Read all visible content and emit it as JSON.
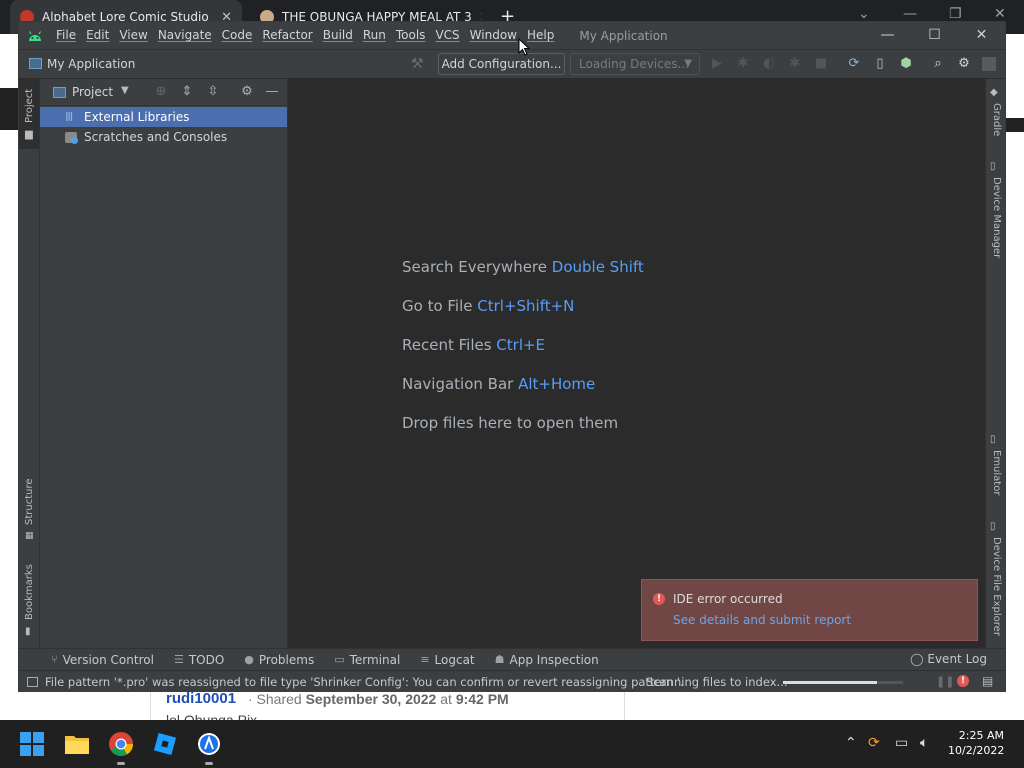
{
  "browser": {
    "tabs": [
      {
        "title": "Alphabet Lore Comic Studio",
        "active": true
      },
      {
        "title": "THE OBUNGA HAPPY MEAL AT 3",
        "active": false
      }
    ],
    "new_tab": "+",
    "close_glyph": "✕",
    "page": {
      "user": "rudi10001",
      "shared_prefix": "· Shared ",
      "shared_date": "September 30, 2022",
      "shared_at": " at ",
      "shared_time": "9:42 PM",
      "line2": "lol Obunga Pix"
    }
  },
  "ide": {
    "app_icon": "android-studio-icon",
    "menu": [
      "File",
      "Edit",
      "View",
      "Navigate",
      "Code",
      "Refactor",
      "Build",
      "Run",
      "Tools",
      "VCS",
      "Window",
      "Help"
    ],
    "window_title": "My Application",
    "project_name": "My Application",
    "toolbar": {
      "add_configuration": "Add Configuration...",
      "devices": "Loading Devices..."
    },
    "left_tabs": [
      "Project",
      "Structure",
      "Bookmarks"
    ],
    "right_tabs": [
      "Gradle",
      "Device Manager",
      "Emulator",
      "Device File Explorer"
    ],
    "project_panel": {
      "title": "Project",
      "items": [
        {
          "label": "External Libraries",
          "icon": "library-icon",
          "selected": true
        },
        {
          "label": "Scratches and Consoles",
          "icon": "scratch-icon",
          "selected": false
        }
      ]
    },
    "editor_tips": [
      {
        "text": "Search Everywhere ",
        "shortcut": "Double Shift"
      },
      {
        "text": "Go to File ",
        "shortcut": "Ctrl+Shift+N"
      },
      {
        "text": "Recent Files ",
        "shortcut": "Ctrl+E"
      },
      {
        "text": "Navigation Bar ",
        "shortcut": "Alt+Home"
      },
      {
        "text": "Drop files here to open them",
        "shortcut": ""
      }
    ],
    "notification": {
      "title": "IDE error occurred",
      "link": "See details and submit report"
    },
    "bottom_tools": [
      "Version Control",
      "TODO",
      "Problems",
      "Terminal",
      "Logcat",
      "App Inspection"
    ],
    "event_log": "Event Log",
    "status": {
      "message": "File pattern '*.pro' was reassigned to file type 'Shrinker Config': You can confirm or revert reassigning pattern '.",
      "task": "Scanning files to index...",
      "progress": 0.78
    },
    "colors": {
      "accent": "#4b6eaf",
      "link": "#589df6",
      "error": "#e55757"
    }
  },
  "taskbar": {
    "apps": [
      "windows-start-icon",
      "file-explorer-icon",
      "chrome-icon",
      "roblox-studio-icon",
      "android-studio-icon"
    ],
    "time": "2:25 AM",
    "date": "10/2/2022"
  }
}
